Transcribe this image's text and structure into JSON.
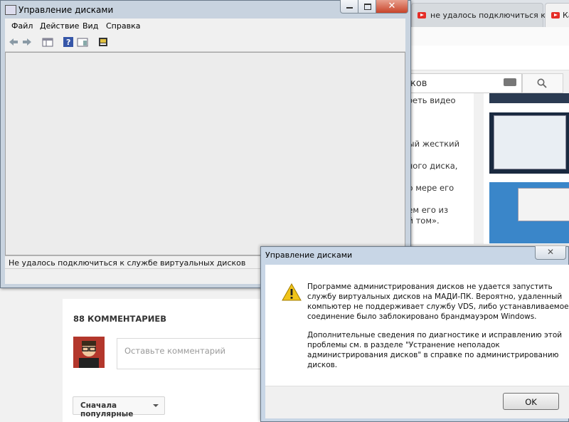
{
  "browser": {
    "tabs": [
      {
        "label": "не удалось подключиться к сл"
      },
      {
        "label": "Ка"
      }
    ],
    "search_value": "ков",
    "description_lines": [
      "треть видео",
      "ный жесткий",
      "ьного диска,",
      "по мере его",
      "рем его из",
      "ий том»."
    ],
    "comments_count": "88 КОММЕНТАРИЕВ",
    "comment_placeholder": "Оставьте комментарий",
    "sort_label": "Сначала популярные"
  },
  "window": {
    "title": "Управление дисками",
    "menu": [
      "Файл",
      "Действие",
      "Вид",
      "Справка"
    ],
    "status": "Не удалось подключиться к службе виртуальных дисков"
  },
  "dialog": {
    "title": "Управление дисками",
    "para1": [
      "Программе администрирования дисков не удается запустить",
      "службу виртуальных дисков на МАДИ-ПК. Вероятно, удаленный",
      "компьютер не поддерживает службу VDS, либо устанавливаемое",
      "соединение было заблокировано брандмауэром Windows."
    ],
    "para2": [
      "Дополнительные сведения по диагностике и исправлению этой",
      "проблемы см. в разделе \"Устранение неполадок",
      "администрирования дисков\" в справке по администрированию",
      "дисков."
    ],
    "ok_label": "OK"
  },
  "colors": {
    "accent": "#e52d27",
    "warning": "#f0c419"
  }
}
